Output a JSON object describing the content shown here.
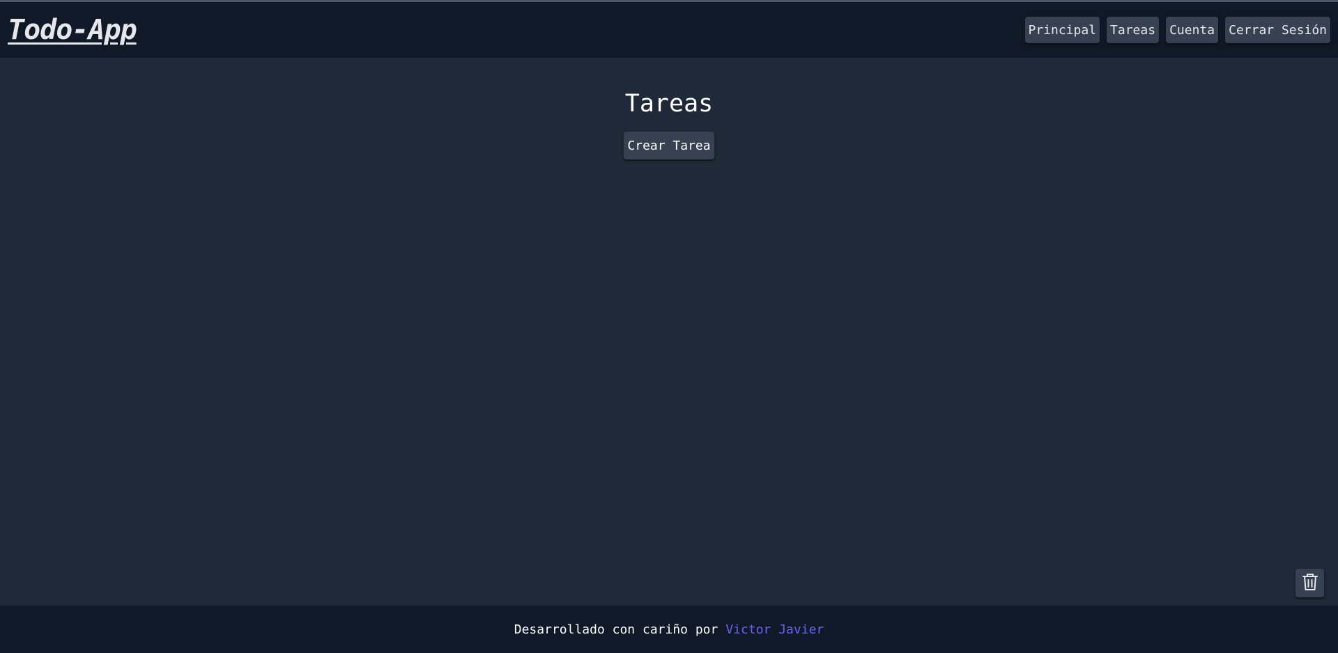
{
  "header": {
    "logo": "Todo-App",
    "nav": [
      {
        "label": "Principal"
      },
      {
        "label": "Tareas"
      },
      {
        "label": "Cuenta"
      },
      {
        "label": "Cerrar Sesión"
      }
    ]
  },
  "main": {
    "title": "Tareas",
    "create_button": "Crear Tarea",
    "trash_icon": "trash-icon"
  },
  "footer": {
    "text": "Desarrollado con cariño por",
    "author": "Victor Javier"
  },
  "colors": {
    "background": "#1f2937",
    "header_footer": "#111827",
    "button": "#374151",
    "link_accent": "#6366f1"
  }
}
